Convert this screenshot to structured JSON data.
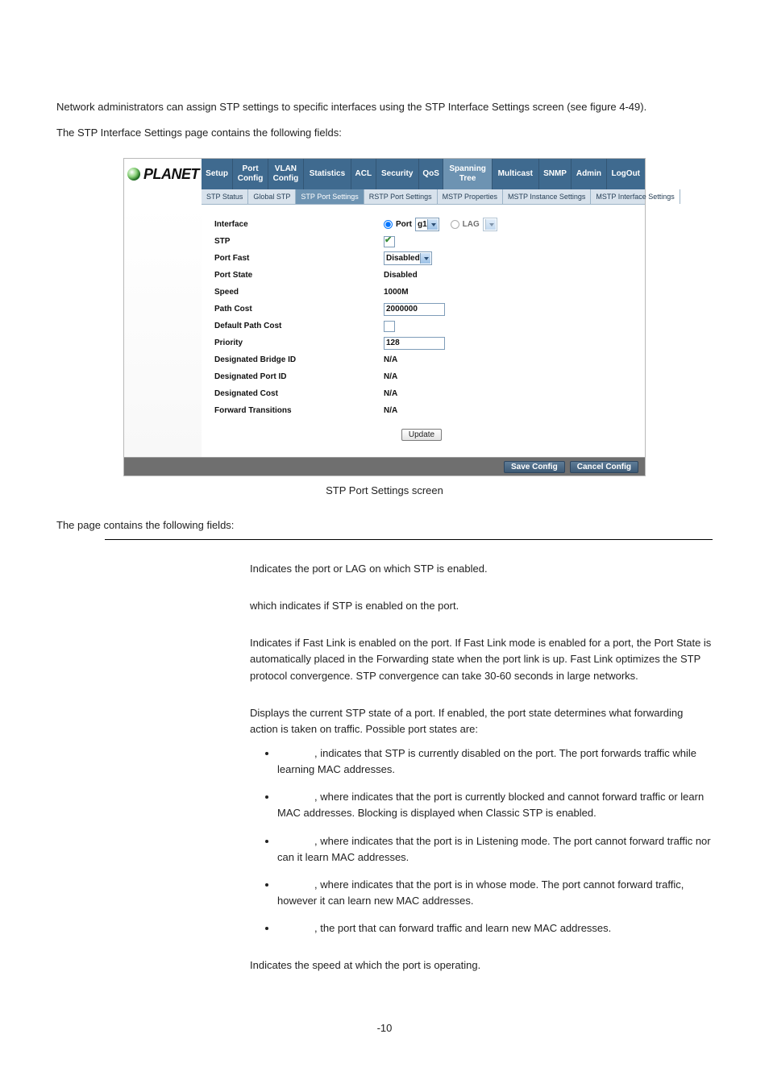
{
  "intro": {
    "p1": "Network administrators can assign STP settings to specific interfaces using the STP Interface Settings screen (see figure 4-49).",
    "p2": "The STP Interface Settings page contains the following fields:"
  },
  "logo_text": "PLANET",
  "menu": {
    "items": [
      "Setup",
      "Port\nConfig",
      "VLAN\nConfig",
      "Statistics",
      "ACL",
      "Security",
      "QoS",
      "Spanning\nTree",
      "Multicast",
      "SNMP",
      "Admin",
      "LogOut"
    ],
    "active_index": 7
  },
  "submenu": {
    "items": [
      "STP Status",
      "Global STP",
      "STP Port Settings",
      "RSTP Port Settings",
      "MSTP Properties",
      "MSTP Instance Settings",
      "MSTP Interface Settings"
    ],
    "active_index": 2
  },
  "form": {
    "rows": [
      {
        "label": "Interface",
        "type": "interface",
        "port_label": "Port",
        "port_value": "g1",
        "lag_label": "LAG",
        "lag_value": ""
      },
      {
        "label": "STP",
        "type": "checkbox",
        "checked": true
      },
      {
        "label": "Port Fast",
        "type": "select",
        "value": "Disabled"
      },
      {
        "label": "Port State",
        "type": "text",
        "value": "Disabled"
      },
      {
        "label": "Speed",
        "type": "text",
        "value": "1000M"
      },
      {
        "label": "Path Cost",
        "type": "input",
        "value": "2000000"
      },
      {
        "label": "Default Path Cost",
        "type": "checkbox",
        "checked": false
      },
      {
        "label": "Priority",
        "type": "input",
        "value": "128"
      },
      {
        "label": "Designated Bridge ID",
        "type": "text",
        "value": "N/A"
      },
      {
        "label": "Designated Port ID",
        "type": "text",
        "value": "N/A"
      },
      {
        "label": "Designated Cost",
        "type": "text",
        "value": "N/A"
      },
      {
        "label": "Forward Transitions",
        "type": "text",
        "value": "N/A"
      }
    ],
    "update_label": "Update"
  },
  "footer_buttons": [
    "Save Config",
    "Cancel Config"
  ],
  "caption": "STP Port Settings screen",
  "after_caption": "The page contains the following fields:",
  "defs": {
    "d1": "Indicates the port or LAG on which STP is enabled.",
    "d2": "which indicates if STP is enabled on the port.",
    "d3": "Indicates if Fast Link is enabled on the port. If Fast Link mode is enabled for a port, the Port State is automatically placed in the Forwarding state when the port link is up. Fast Link optimizes the STP protocol convergence. STP convergence can take 30-60 seconds in large networks.",
    "d4_intro": "Displays the current STP state of a port. If enabled, the port state determines what forwarding action is taken on traffic. Possible port states are:",
    "bullets": [
      ", indicates that STP is currently disabled on the port. The port forwards traffic while learning MAC addresses.",
      ", where indicates that the port is currently blocked and cannot forward traffic or learn MAC addresses. Blocking is displayed when Classic STP is enabled.",
      ", where indicates that the port is in Listening mode. The port cannot forward traffic nor can it learn MAC addresses.",
      ", where indicates that the port is in whose mode. The port cannot forward traffic, however it can learn new MAC addresses.",
      ", the port that can forward traffic and learn new MAC addresses."
    ],
    "d5": "Indicates the speed at which the port is operating."
  },
  "page_number": "-10"
}
